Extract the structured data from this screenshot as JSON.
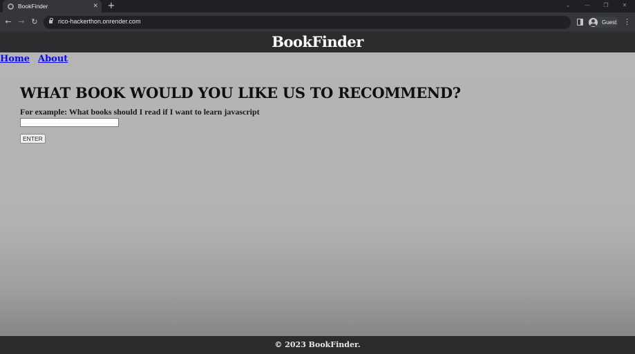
{
  "browser": {
    "tab": {
      "title": "BookFinder",
      "close_glyph": "✕",
      "favicon": "globe-icon"
    },
    "new_tab_glyph": "+",
    "window_controls": {
      "tab_search": "⌄",
      "minimize": "—",
      "restore": "❐",
      "close": "✕"
    },
    "toolbar": {
      "back_glyph": "←",
      "forward_glyph": "→",
      "reload_glyph": "↻",
      "url": "rico-hackerthon.onrender.com",
      "profile_label": "Guest",
      "menu_glyph": "⋮"
    }
  },
  "page": {
    "site_title": "BookFinder",
    "nav": [
      {
        "label": "Home"
      },
      {
        "label": "About"
      }
    ],
    "heading": "WHAT BOOK WOULD YOU LIKE US TO RECOMMEND?",
    "example_label": "For example: What books should I read if I want to learn javascript",
    "query_input": {
      "value": "",
      "placeholder": ""
    },
    "enter_button": "ENTER",
    "footer": "© 2023 BookFinder."
  },
  "colors": {
    "chrome_dark": "#1f2023",
    "chrome_toolbar": "#35363a",
    "header_bg": "#2c2c2e",
    "page_bg": "#b6b4b5",
    "link": "#0a0af0"
  }
}
